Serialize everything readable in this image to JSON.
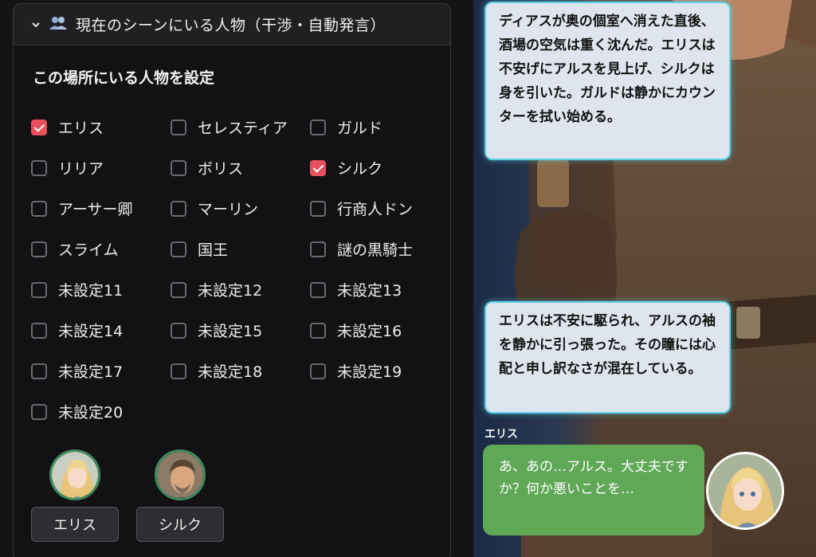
{
  "panel": {
    "header_title": "現在のシーンにいる人物（干渉・自動発言）",
    "header_icon": "people-icon",
    "section_title": "この場所にいる人物を設定"
  },
  "characters": {
    "col1": [
      {
        "label": "エリス",
        "checked": true
      },
      {
        "label": "リリア",
        "checked": false
      },
      {
        "label": "アーサー卿",
        "checked": false
      },
      {
        "label": "スライム",
        "checked": false
      },
      {
        "label": "未設定11",
        "checked": false
      },
      {
        "label": "未設定14",
        "checked": false
      },
      {
        "label": "未設定17",
        "checked": false
      },
      {
        "label": "未設定20",
        "checked": false
      }
    ],
    "col2": [
      {
        "label": "セレスティア",
        "checked": false
      },
      {
        "label": "ボリス",
        "checked": false
      },
      {
        "label": "マーリン",
        "checked": false
      },
      {
        "label": "国王",
        "checked": false
      },
      {
        "label": "未設定12",
        "checked": false
      },
      {
        "label": "未設定15",
        "checked": false
      },
      {
        "label": "未設定18",
        "checked": false
      }
    ],
    "col3": [
      {
        "label": "ガルド",
        "checked": false
      },
      {
        "label": "シルク",
        "checked": true
      },
      {
        "label": "行商人ドン",
        "checked": false
      },
      {
        "label": "謎の黒騎士",
        "checked": false
      },
      {
        "label": "未設定13",
        "checked": false
      },
      {
        "label": "未設定16",
        "checked": false
      },
      {
        "label": "未設定19",
        "checked": false
      }
    ]
  },
  "active": [
    {
      "name": "エリス",
      "avatar": "blonde-girl-avatar"
    },
    {
      "name": "シルク",
      "avatar": "older-man-avatar"
    }
  ],
  "chat": {
    "narration1": "ディアスが奥の個室へ消えた直後、酒場の空気は重く沈んだ。エリスは不安げにアルスを見上げ、シルクは身を引いた。ガルドは静かにカウンターを拭い始める。",
    "narration2": "エリスは不安に駆られ、アルスの袖を静かに引っ張った。その瞳には心配と申し訳なさが混在している。",
    "speaker": "エリス",
    "message": "あ、あの…アルス。大丈夫ですか？何か悪いことを…"
  },
  "colors": {
    "accent_checkbox": "#e8505b",
    "speech_bubble": "#5fa856",
    "narration_border": "#5fd2e8"
  }
}
